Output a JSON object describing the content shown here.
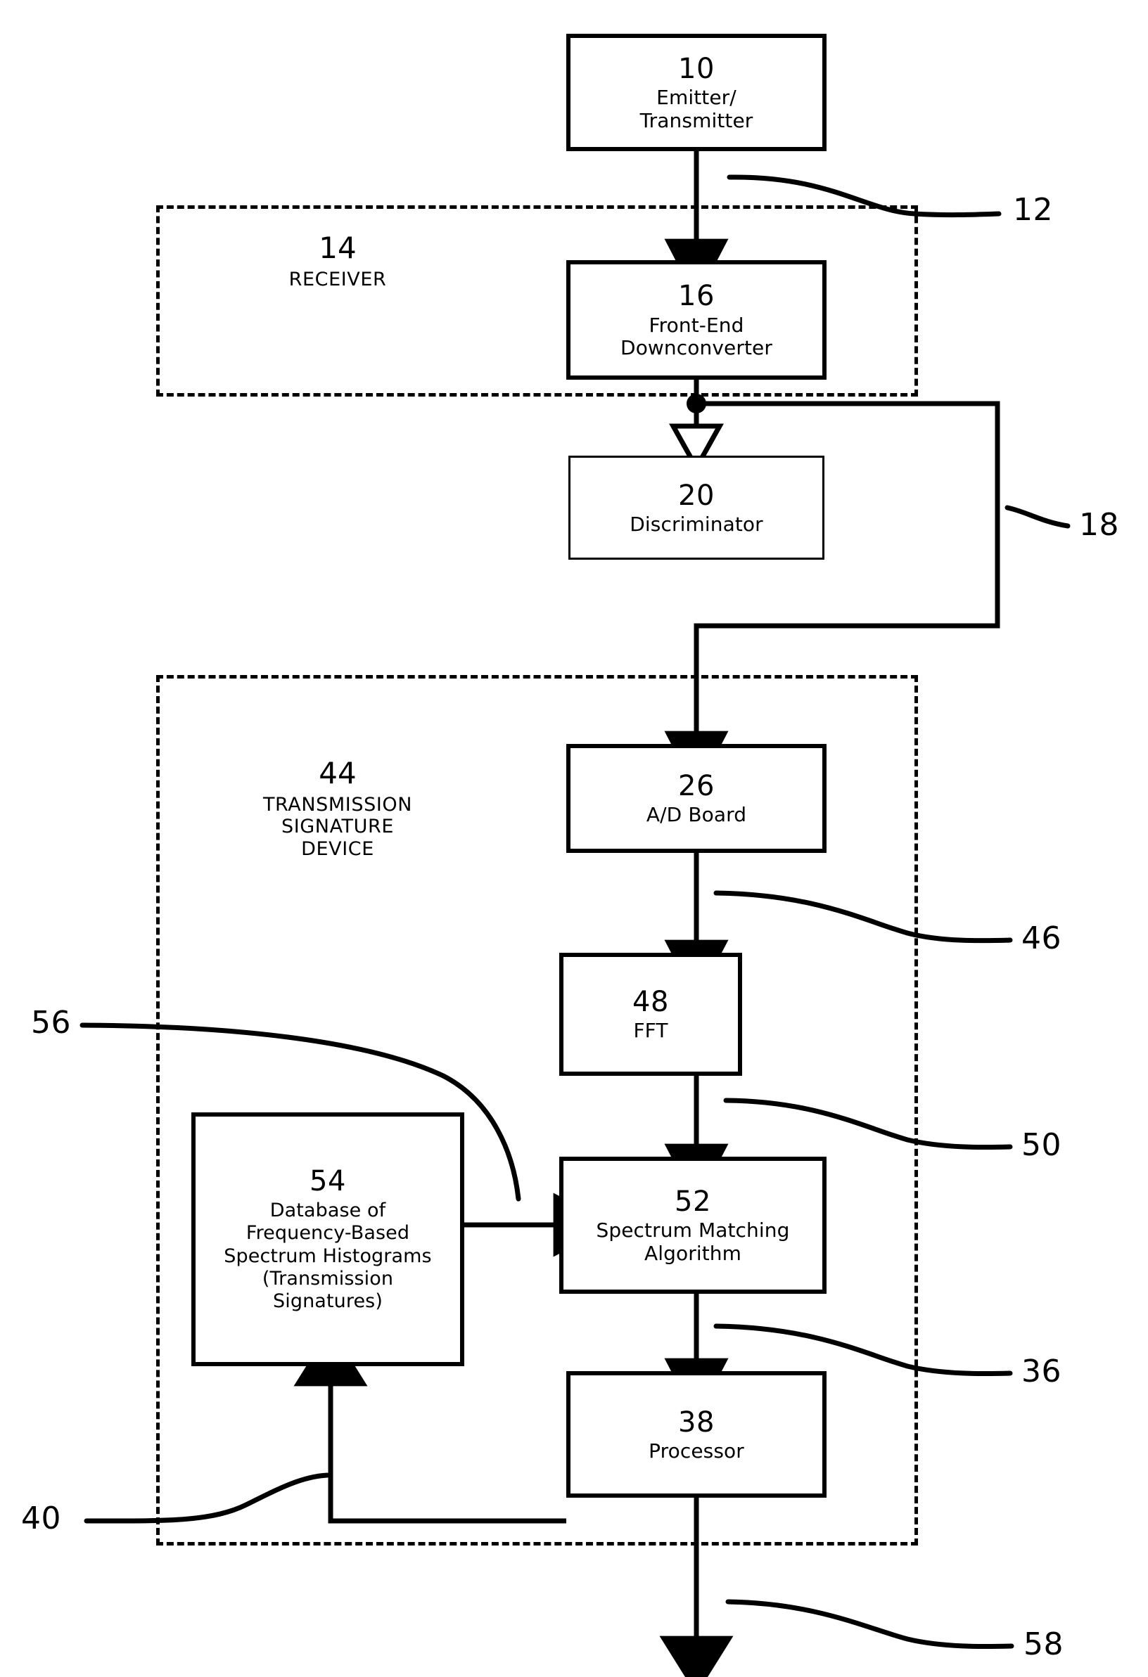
{
  "figure": {
    "type": "patent-block-diagram",
    "title": "",
    "line_color": "#000000",
    "background_color": "#ffffff"
  },
  "blocks": [
    {
      "id": "10",
      "number": "10",
      "caption_lines": [
        "Emitter/",
        "Transmitter"
      ]
    },
    {
      "id": "16",
      "number": "16",
      "caption_lines": [
        "Front-End",
        "Downconverter"
      ]
    },
    {
      "id": "20",
      "number": "20",
      "caption_lines": [
        "Discriminator"
      ]
    },
    {
      "id": "26",
      "number": "26",
      "caption_lines": [
        "A/D Board"
      ]
    },
    {
      "id": "48",
      "number": "48",
      "caption_lines": [
        "FFT"
      ]
    },
    {
      "id": "52",
      "number": "52",
      "caption_lines": [
        "Spectrum Matching",
        "Algorithm"
      ]
    },
    {
      "id": "54",
      "number": "54",
      "caption_lines": [
        "Database of",
        "Frequency-Based",
        "Spectrum Histograms",
        "(Transmission",
        "Signatures)"
      ]
    },
    {
      "id": "38",
      "number": "38",
      "caption_lines": [
        "Processor"
      ]
    }
  ],
  "regions": [
    {
      "id": "14",
      "number": "14",
      "caption_lines": [
        "RECEIVER"
      ]
    },
    {
      "id": "44",
      "number": "44",
      "caption_lines": [
        "TRANSMISSION",
        "SIGNATURE",
        "DEVICE"
      ]
    }
  ],
  "reference_numerals": [
    {
      "id": "12",
      "label": "12"
    },
    {
      "id": "18",
      "label": "18"
    },
    {
      "id": "46",
      "label": "46"
    },
    {
      "id": "50",
      "label": "50"
    },
    {
      "id": "36",
      "label": "36"
    },
    {
      "id": "56",
      "label": "56"
    },
    {
      "id": "40",
      "label": "40"
    },
    {
      "id": "58",
      "label": "58"
    }
  ]
}
